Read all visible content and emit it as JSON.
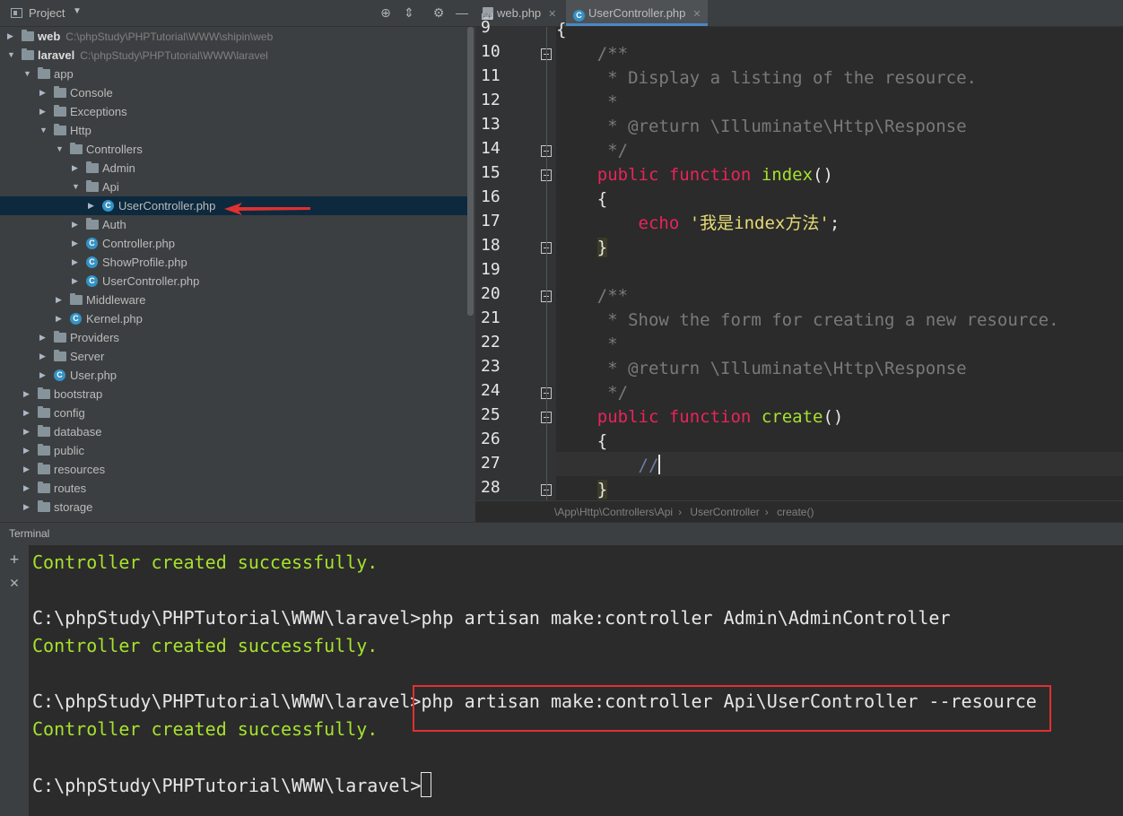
{
  "project_panel": {
    "title": "Project",
    "tree": [
      {
        "label": "web",
        "path": "C:\\phpStudy\\PHPTutorial\\WWW\\shipin\\web",
        "icon": "folder-icon",
        "expanded": false,
        "bold": true
      },
      {
        "label": "laravel",
        "path": "C:\\phpStudy\\PHPTutorial\\WWW\\laravel",
        "icon": "folder-icon",
        "expanded": true,
        "bold": true
      },
      {
        "label": "app",
        "icon": "folder-icon",
        "expanded": true
      },
      {
        "label": "Console",
        "icon": "folder-icon",
        "expanded": false
      },
      {
        "label": "Exceptions",
        "icon": "folder-icon",
        "expanded": false
      },
      {
        "label": "Http",
        "icon": "folder-icon",
        "expanded": true
      },
      {
        "label": "Controllers",
        "icon": "folder-icon",
        "expanded": true
      },
      {
        "label": "Admin",
        "icon": "folder-icon",
        "expanded": false
      },
      {
        "label": "Api",
        "icon": "folder-icon",
        "expanded": true
      },
      {
        "label": "UserController.php",
        "icon": "php-class-icon",
        "expanded": false,
        "selected": true
      },
      {
        "label": "Auth",
        "icon": "folder-icon",
        "expanded": false
      },
      {
        "label": "Controller.php",
        "icon": "php-class-icon",
        "expanded": false
      },
      {
        "label": "ShowProfile.php",
        "icon": "php-class-icon",
        "expanded": false
      },
      {
        "label": "UserController.php",
        "icon": "php-class-icon",
        "expanded": false
      },
      {
        "label": "Middleware",
        "icon": "folder-icon",
        "expanded": false
      },
      {
        "label": "Kernel.php",
        "icon": "php-class-icon",
        "expanded": false
      },
      {
        "label": "Providers",
        "icon": "folder-icon",
        "expanded": false
      },
      {
        "label": "Server",
        "icon": "folder-icon",
        "expanded": false
      },
      {
        "label": "User.php",
        "icon": "php-class-icon",
        "expanded": false
      },
      {
        "label": "bootstrap",
        "icon": "folder-icon",
        "expanded": false
      },
      {
        "label": "config",
        "icon": "folder-icon",
        "expanded": false
      },
      {
        "label": "database",
        "icon": "folder-icon",
        "expanded": false
      },
      {
        "label": "public",
        "icon": "folder-icon",
        "expanded": false
      },
      {
        "label": "resources",
        "icon": "folder-icon",
        "expanded": false
      },
      {
        "label": "routes",
        "icon": "folder-icon",
        "expanded": false
      },
      {
        "label": "storage",
        "icon": "folder-icon",
        "expanded": false
      }
    ]
  },
  "editor": {
    "tabs": [
      {
        "label": "web.php",
        "icon": "php-file-icon",
        "active": false
      },
      {
        "label": "UserController.php",
        "icon": "php-class-icon",
        "active": true
      }
    ],
    "line_numbers": [
      "9",
      "10",
      "11",
      "12",
      "13",
      "14",
      "15",
      "16",
      "17",
      "18",
      "19",
      "20",
      "21",
      "22",
      "23",
      "24",
      "25",
      "26",
      "27",
      "28"
    ],
    "lines": {
      "l9": "{",
      "l10": "    /**",
      "l11": "     * Display a listing of the resource.",
      "l12": "     *",
      "l13": "     * @return \\Illuminate\\Http\\Response",
      "l14": "     */",
      "l15_kw1": "public",
      "l15_kw2": "function",
      "l15_fn": "index",
      "l15_tail": "()",
      "l16": "{",
      "l17_kw": "echo",
      "l17_str": "'我是index方法'",
      "l17_tail": ";",
      "l18": "}",
      "l20": "    /**",
      "l21": "     * Show the form for creating a new resource.",
      "l22": "     *",
      "l23": "     * @return \\Illuminate\\Http\\Response",
      "l24": "     */",
      "l25_kw1": "public",
      "l25_kw2": "function",
      "l25_fn": "create",
      "l25_tail": "()",
      "l26": "{",
      "l27": "//",
      "l28": "}"
    },
    "breadcrumb": [
      "\\App\\Http\\Controllers\\Api",
      "UserController",
      "create()"
    ]
  },
  "terminal": {
    "title": "Terminal",
    "lines": [
      {
        "type": "ok",
        "text": "Controller created successfully."
      },
      {
        "type": "blank",
        "text": ""
      },
      {
        "type": "cmd",
        "text": "C:\\phpStudy\\PHPTutorial\\WWW\\laravel>php artisan make:controller Admin\\AdminController"
      },
      {
        "type": "ok",
        "text": "Controller created successfully."
      },
      {
        "type": "blank",
        "text": ""
      },
      {
        "type": "cmd",
        "text": "C:\\phpStudy\\PHPTutorial\\WWW\\laravel>php artisan make:controller Api\\UserController --resource"
      },
      {
        "type": "ok",
        "text": "Controller created successfully."
      },
      {
        "type": "blank",
        "text": ""
      },
      {
        "type": "cmd",
        "text": "C:\\phpStudy\\PHPTutorial\\WWW\\laravel>"
      }
    ]
  },
  "colors": {
    "keyword": "#e8245c",
    "function": "#a6e22e",
    "string": "#e6db74",
    "doc_comment": "#7a7a7a",
    "success": "#a6e22e",
    "annotation": "#e03030",
    "selection": "#0d293e"
  }
}
